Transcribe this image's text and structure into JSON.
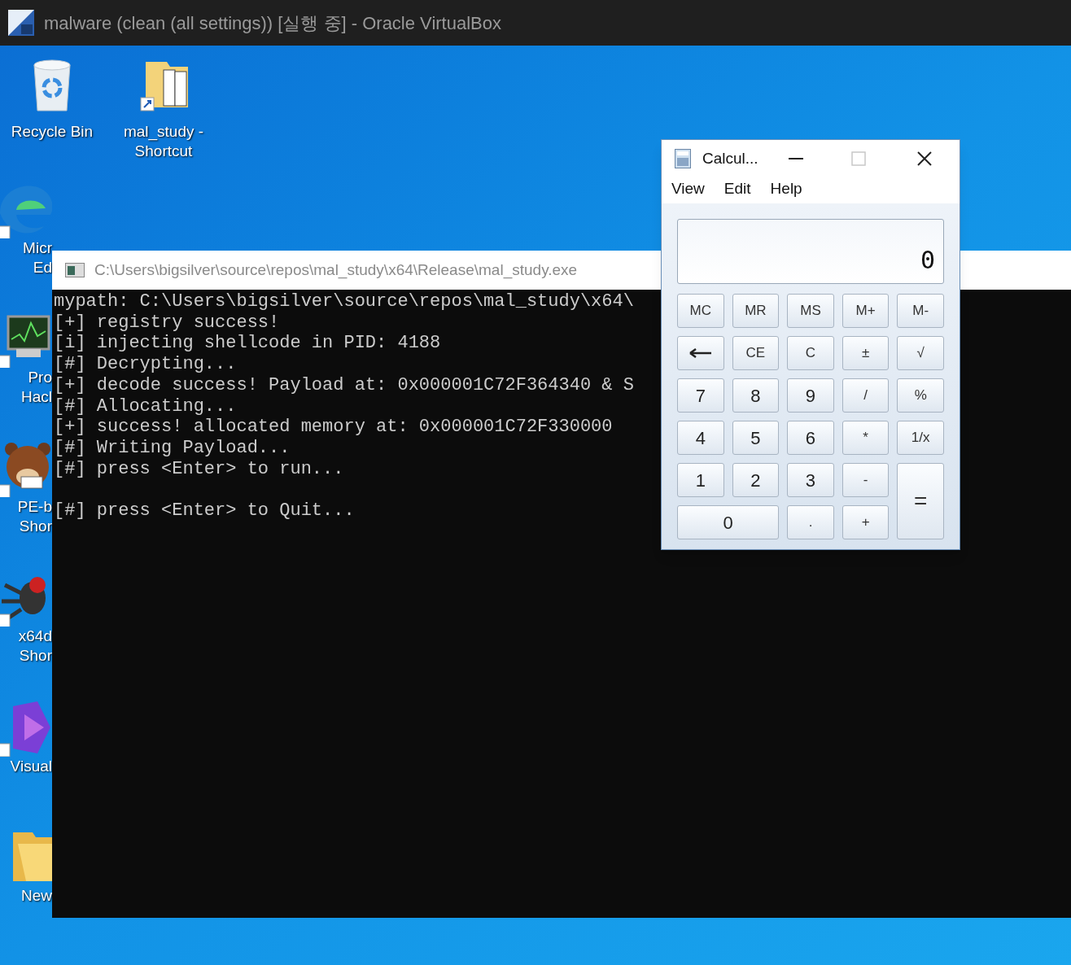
{
  "host_window": {
    "title": "malware (clean (all settings)) [실행 중] - Oracle VirtualBox"
  },
  "top_icons": [
    {
      "kind": "recycle",
      "lines": [
        "Recycle Bin"
      ]
    },
    {
      "kind": "folder_shortcut",
      "lines": [
        "mal_study -",
        "Shortcut"
      ]
    }
  ],
  "left_icons": [
    {
      "kind": "edge",
      "lines": [
        "Micr",
        "Ed"
      ]
    },
    {
      "kind": "monitor",
      "lines": [
        "Pro",
        "Hacl"
      ]
    },
    {
      "kind": "bear",
      "lines": [
        "PE-b",
        "Shor"
      ]
    },
    {
      "kind": "bug",
      "lines": [
        "x64d",
        "Shor"
      ]
    },
    {
      "kind": "studio",
      "lines": [
        "Visual"
      ]
    },
    {
      "kind": "folder",
      "lines": [
        "New"
      ]
    }
  ],
  "console": {
    "title": "C:\\Users\\bigsilver\\source\\repos\\mal_study\\x64\\Release\\mal_study.exe",
    "lines": [
      "mypath: C:\\Users\\bigsilver\\source\\repos\\mal_study\\x64\\",
      "[+] registry success!",
      "[i] injecting shellcode in PID: 4188",
      "[#] Decrypting...",
      "[+] decode success! Payload at: 0x000001C72F364340 & S",
      "[#] Allocating...",
      "[+] success! allocated memory at: 0x000001C72F330000",
      "[#] Writing Payload...",
      "[#] press <Enter> to run...",
      "[#] press <Enter> to Quit..."
    ]
  },
  "calculator": {
    "title": "Calcul...",
    "menu": [
      "View",
      "Edit",
      "Help"
    ],
    "display": "0",
    "keys": [
      {
        "label": "MC",
        "kind": "memory"
      },
      {
        "label": "MR",
        "kind": "memory"
      },
      {
        "label": "MS",
        "kind": "memory"
      },
      {
        "label": "M+",
        "kind": "memory"
      },
      {
        "label": "M-",
        "kind": "memory"
      },
      {
        "kind": "backspace"
      },
      {
        "label": "CE",
        "kind": "op"
      },
      {
        "label": "C",
        "kind": "op"
      },
      {
        "label": "±",
        "kind": "op"
      },
      {
        "label": "√",
        "kind": "op"
      },
      {
        "label": "7",
        "kind": "digit"
      },
      {
        "label": "8",
        "kind": "digit"
      },
      {
        "label": "9",
        "kind": "digit"
      },
      {
        "label": "/",
        "kind": "op"
      },
      {
        "label": "%",
        "kind": "op"
      },
      {
        "label": "4",
        "kind": "digit"
      },
      {
        "label": "5",
        "kind": "digit"
      },
      {
        "label": "6",
        "kind": "digit"
      },
      {
        "label": "*",
        "kind": "op"
      },
      {
        "label": "1/x",
        "kind": "op"
      },
      {
        "label": "1",
        "kind": "digit"
      },
      {
        "label": "2",
        "kind": "digit"
      },
      {
        "label": "3",
        "kind": "digit"
      },
      {
        "label": "-",
        "kind": "op"
      },
      {
        "label": "=",
        "kind": "tall"
      },
      {
        "label": "0",
        "kind": "wide"
      },
      {
        "label": ".",
        "kind": "op"
      },
      {
        "label": "+",
        "kind": "op"
      }
    ]
  }
}
